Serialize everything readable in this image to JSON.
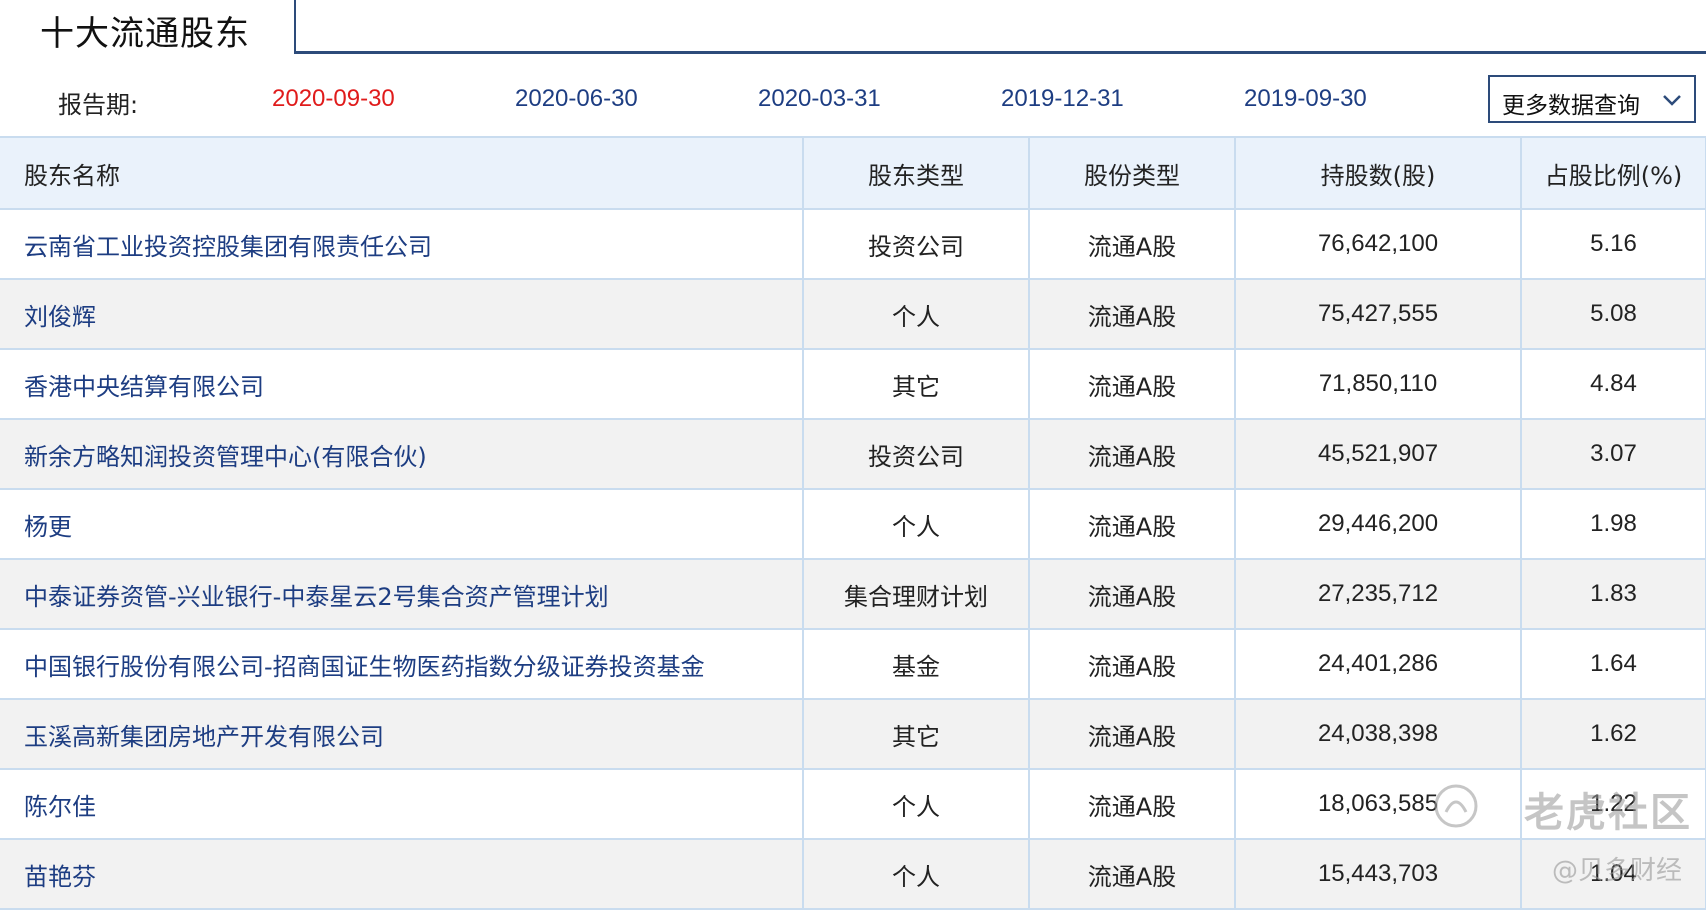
{
  "header": {
    "title": "十大流通股东"
  },
  "periods": {
    "label": "报告期:",
    "items": [
      "2020-09-30",
      "2020-06-30",
      "2020-03-31",
      "2019-12-31",
      "2019-09-30"
    ],
    "active_index": 0,
    "more_label": "更多数据查询"
  },
  "table": {
    "columns": [
      "股东名称",
      "股东类型",
      "股份类型",
      "持股数(股)",
      "占股比例(%)"
    ],
    "rows": [
      {
        "name": "云南省工业投资控股集团有限责任公司",
        "holder_type": "投资公司",
        "share_type": "流通A股",
        "shares": "76,642,100",
        "ratio": "5.16"
      },
      {
        "name": "刘俊辉",
        "holder_type": "个人",
        "share_type": "流通A股",
        "shares": "75,427,555",
        "ratio": "5.08"
      },
      {
        "name": "香港中央结算有限公司",
        "holder_type": "其它",
        "share_type": "流通A股",
        "shares": "71,850,110",
        "ratio": "4.84"
      },
      {
        "name": "新余方略知润投资管理中心(有限合伙)",
        "holder_type": "投资公司",
        "share_type": "流通A股",
        "shares": "45,521,907",
        "ratio": "3.07"
      },
      {
        "name": "杨更",
        "holder_type": "个人",
        "share_type": "流通A股",
        "shares": "29,446,200",
        "ratio": "1.98"
      },
      {
        "name": "中泰证券资管-兴业银行-中泰星云2号集合资产管理计划",
        "holder_type": "集合理财计划",
        "share_type": "流通A股",
        "shares": "27,235,712",
        "ratio": "1.83"
      },
      {
        "name": "中国银行股份有限公司-招商国证生物医药指数分级证券投资基金",
        "holder_type": "基金",
        "share_type": "流通A股",
        "shares": "24,401,286",
        "ratio": "1.64"
      },
      {
        "name": "玉溪高新集团房地产开发有限公司",
        "holder_type": "其它",
        "share_type": "流通A股",
        "shares": "24,038,398",
        "ratio": "1.62"
      },
      {
        "name": "陈尔佳",
        "holder_type": "个人",
        "share_type": "流通A股",
        "shares": "18,063,585",
        "ratio": "1.22"
      },
      {
        "name": "苗艳芬",
        "holder_type": "个人",
        "share_type": "流通A股",
        "shares": "15,443,703",
        "ratio": "1.04"
      }
    ]
  },
  "watermark": {
    "brand": "老虎社区",
    "author": "@贝多财经"
  },
  "colors": {
    "active_period": "#e01b1b",
    "link": "#1d3d82",
    "header_bg": "#eaf2fb",
    "border": "#c9dcef",
    "frame": "#2d4b7a"
  }
}
